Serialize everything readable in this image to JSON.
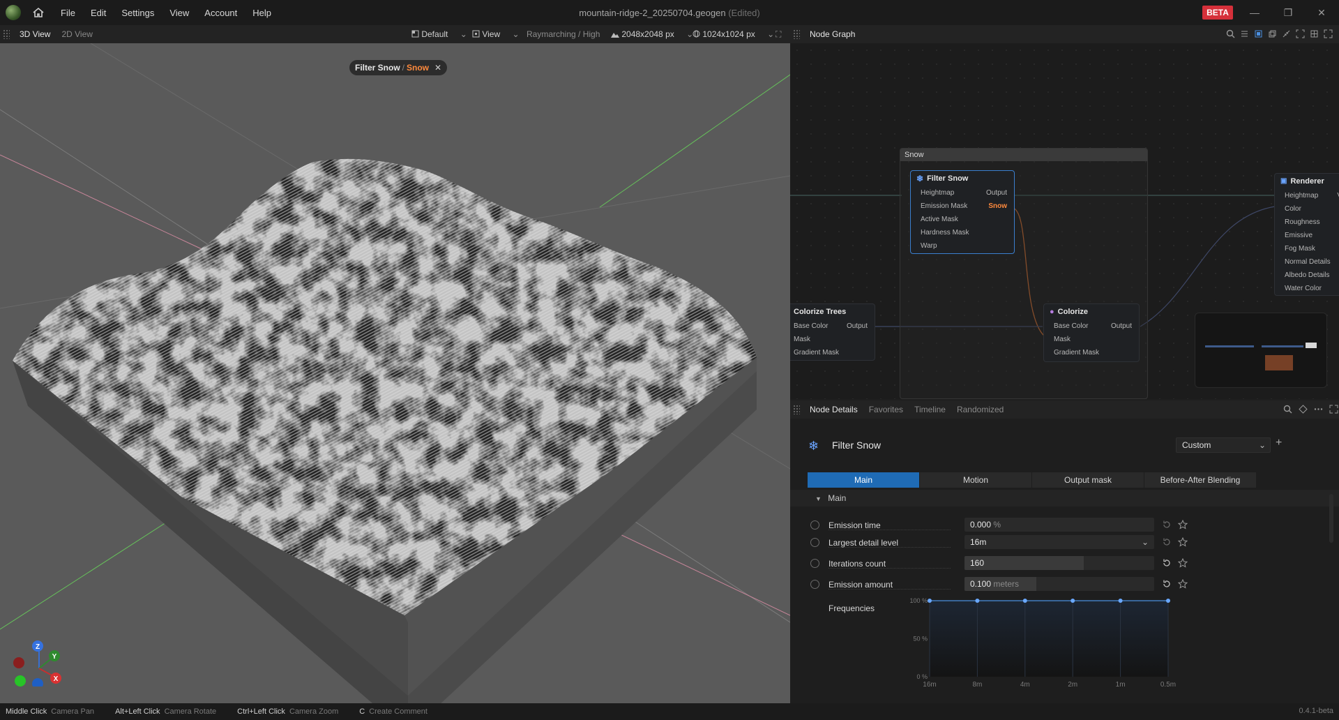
{
  "menu": [
    "File",
    "Edit",
    "Settings",
    "View",
    "Account",
    "Help"
  ],
  "document": {
    "title": "mountain-ridge-2_20250704.geogen",
    "state": "(Edited)"
  },
  "beta_label": "BETA",
  "viewport": {
    "tabs": [
      "3D View",
      "2D View"
    ],
    "preset": "Default",
    "view_label": "View",
    "render_mode": "Raymarching / High",
    "resolution": "2048x2048 px",
    "output_res": "1024x1024 px",
    "breadcrumb": {
      "parent": "Filter Snow",
      "sep": "/",
      "current": "Snow"
    },
    "gizmo": {
      "z": "Z",
      "y": "Y",
      "x": "X"
    }
  },
  "node_graph": {
    "title": "Node Graph",
    "group_label": "Snow",
    "nodes": {
      "filter_snow": {
        "title": "Filter Snow",
        "inputs": [
          "Heightmap",
          "Emission Mask",
          "Active Mask",
          "Hardness Mask",
          "Warp"
        ],
        "outputs": [
          "Output",
          "Snow"
        ]
      },
      "colorize_trees": {
        "title": "Colorize Trees",
        "inputs": [
          "Base Color",
          "Mask",
          "Gradient Mask"
        ],
        "outputs": [
          "Output"
        ]
      },
      "colorize": {
        "title": "Colorize",
        "inputs": [
          "Base Color",
          "Mask",
          "Gradient Mask"
        ],
        "outputs": [
          "Output"
        ]
      },
      "renderer": {
        "title": "Renderer",
        "inputs": [
          "Heightmap",
          "Color",
          "Roughness",
          "Emissive",
          "Fog Mask",
          "Normal Details",
          "Albedo Details",
          "Water Color"
        ],
        "outputs": [
          "V"
        ]
      }
    }
  },
  "node_details": {
    "tabs": [
      "Node Details",
      "Favorites",
      "Timeline",
      "Randomized"
    ],
    "node_title": "Filter Snow",
    "preset": "Custom",
    "param_tabs": [
      "Main",
      "Motion",
      "Output mask",
      "Before-After Blending"
    ],
    "section": "Main",
    "params": [
      {
        "label": "Emission time",
        "value": "0.000",
        "unit": "%",
        "fill": 0
      },
      {
        "label": "Largest detail level",
        "value": "16m",
        "unit": "",
        "fill": 0
      },
      {
        "label": "Iterations count",
        "value": "160",
        "unit": "",
        "fill": 0.63
      },
      {
        "label": "Emission amount",
        "value": "0.100",
        "unit": "meters",
        "fill": 0.38
      }
    ],
    "frequencies": {
      "label": "Frequencies",
      "y_ticks": [
        "100 %",
        "50 %",
        "0 %"
      ],
      "x_ticks": [
        "16m",
        "8m",
        "4m",
        "2m",
        "1m",
        "0.5m"
      ],
      "values": [
        100,
        100,
        100,
        100,
        100,
        100
      ]
    }
  },
  "status": [
    {
      "key": "Middle Click",
      "value": "Camera Pan"
    },
    {
      "key": "Alt+Left Click",
      "value": "Camera Rotate"
    },
    {
      "key": "Ctrl+Left Click",
      "value": "Camera Zoom"
    },
    {
      "key": "C",
      "value": "Create Comment"
    }
  ],
  "version": "0.4.1-beta"
}
